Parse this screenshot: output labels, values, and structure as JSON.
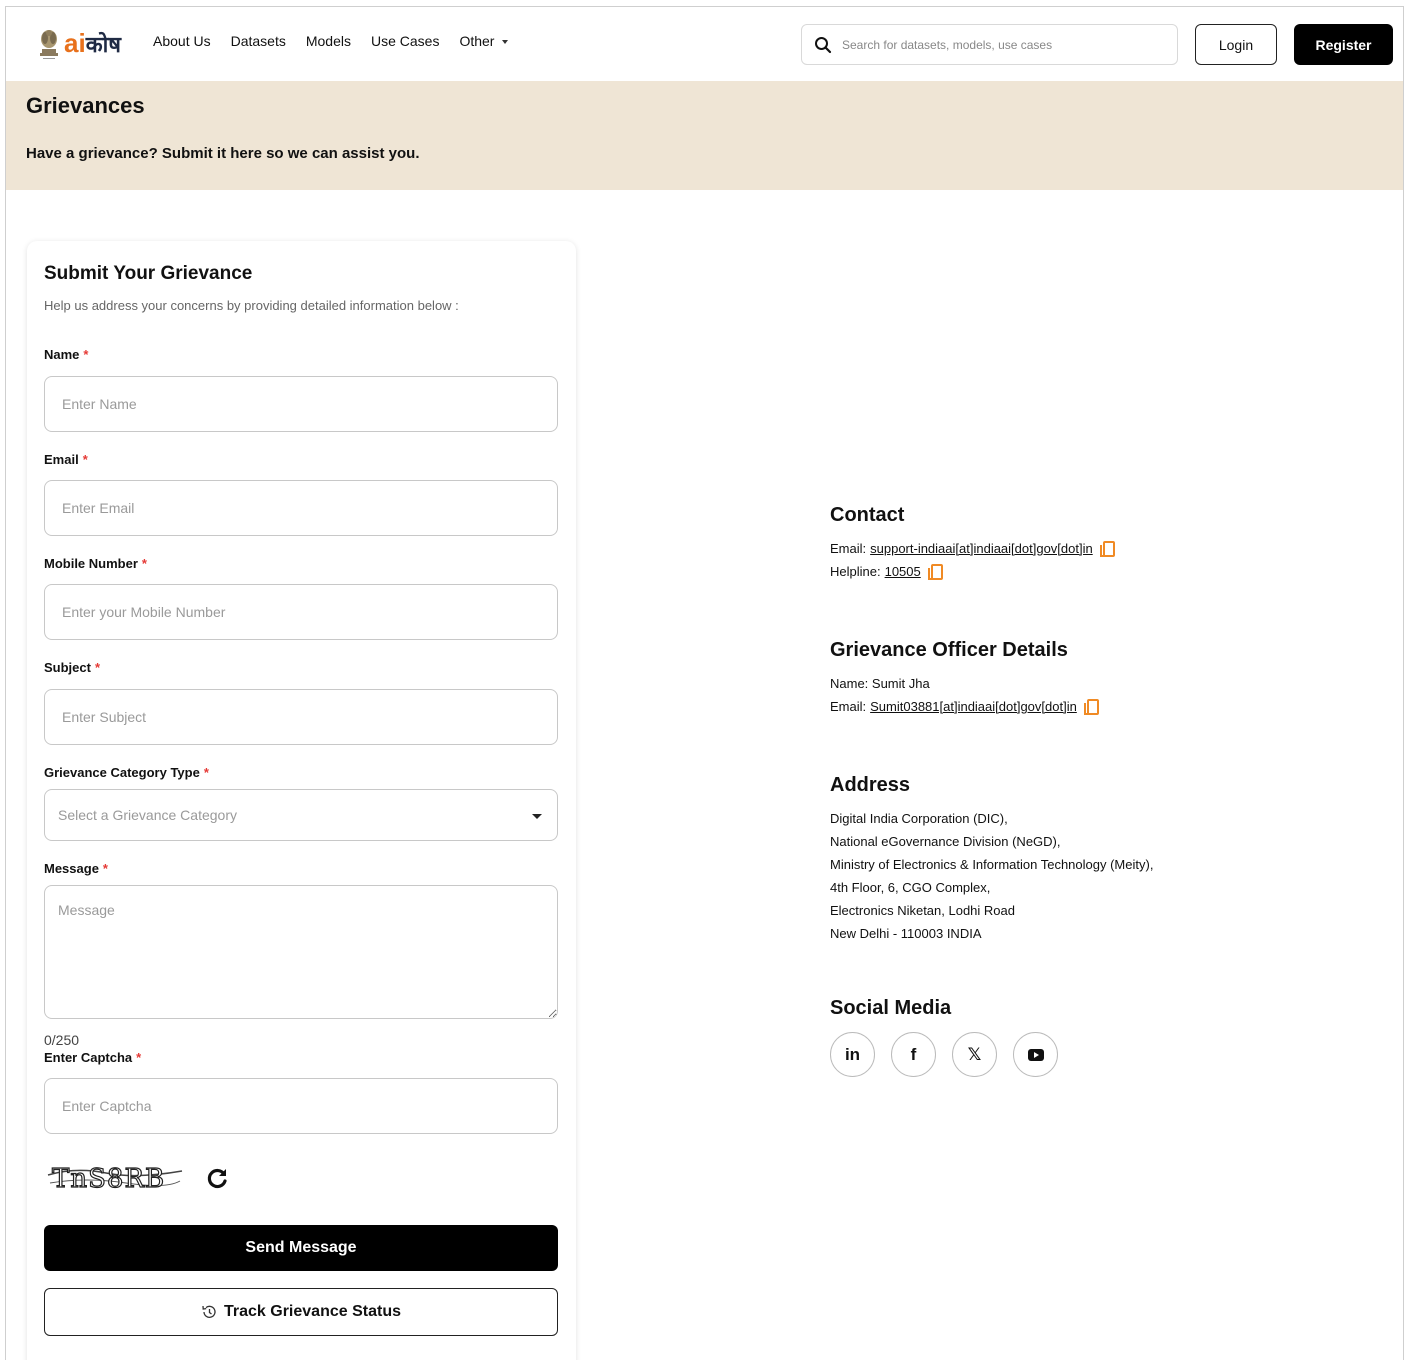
{
  "nav": {
    "logo_ai": "ai",
    "logo_kosh": "कोष",
    "links": [
      "About Us",
      "Datasets",
      "Models",
      "Use Cases",
      "Other"
    ],
    "search_placeholder": "Search for datasets, models, use cases",
    "login_label": "Login",
    "register_label": "Register"
  },
  "banner": {
    "title": "Grievances",
    "subtitle": "Have a grievance? Submit it here so we can assist you."
  },
  "form": {
    "title": "Submit Your Grievance",
    "subtitle": "Help us address your concerns by providing detailed information below :",
    "required_mark": "*",
    "name_label": "Name",
    "name_placeholder": "Enter Name",
    "email_label": "Email",
    "email_placeholder": "Enter Email",
    "mobile_label": "Mobile Number",
    "mobile_placeholder": "Enter your Mobile Number",
    "subject_label": "Subject",
    "subject_placeholder": "Enter Subject",
    "category_label": "Grievance Category Type",
    "category_placeholder": "Select a Grievance Category",
    "message_label": "Message",
    "message_placeholder": "Message",
    "counter": "0/250",
    "captcha_label": "Enter Captcha",
    "captcha_placeholder": "Enter Captcha",
    "captcha_text": "TnS8RB",
    "send_label": "Send Message",
    "track_label": "Track Grievance Status"
  },
  "contact": {
    "title": "Contact",
    "email_prefix": "Email:",
    "email": "support-indiaai[at]indiaai[dot]gov[dot]in",
    "helpline_prefix": "Helpline:",
    "helpline": "10505"
  },
  "officer": {
    "title": "Grievance Officer Details",
    "name_line": "Name: Sumit Jha",
    "email_prefix": "Email:",
    "email": "Sumit03881[at]indiaai[dot]gov[dot]in"
  },
  "address": {
    "title": "Address",
    "lines": [
      "Digital India Corporation (DIC),",
      "National eGovernance Division (NeGD),",
      "Ministry of Electronics & Information Technology (Meity),",
      "4th Floor, 6, CGO Complex,",
      "Electronics Niketan, Lodhi Road",
      "New Delhi - 110003 INDIA"
    ]
  },
  "social": {
    "title": "Social Media",
    "items": [
      {
        "icon": "linkedin-icon",
        "glyph": "in"
      },
      {
        "icon": "facebook-icon",
        "glyph": "f"
      },
      {
        "icon": "x-icon",
        "glyph": "𝕏"
      },
      {
        "icon": "youtube-icon",
        "glyph": "▶"
      }
    ]
  },
  "colors": {
    "banner_bg": "#efe5d5",
    "accent_orange": "#e8711c",
    "required_red": "#e53935",
    "primary_button": "#000000"
  }
}
